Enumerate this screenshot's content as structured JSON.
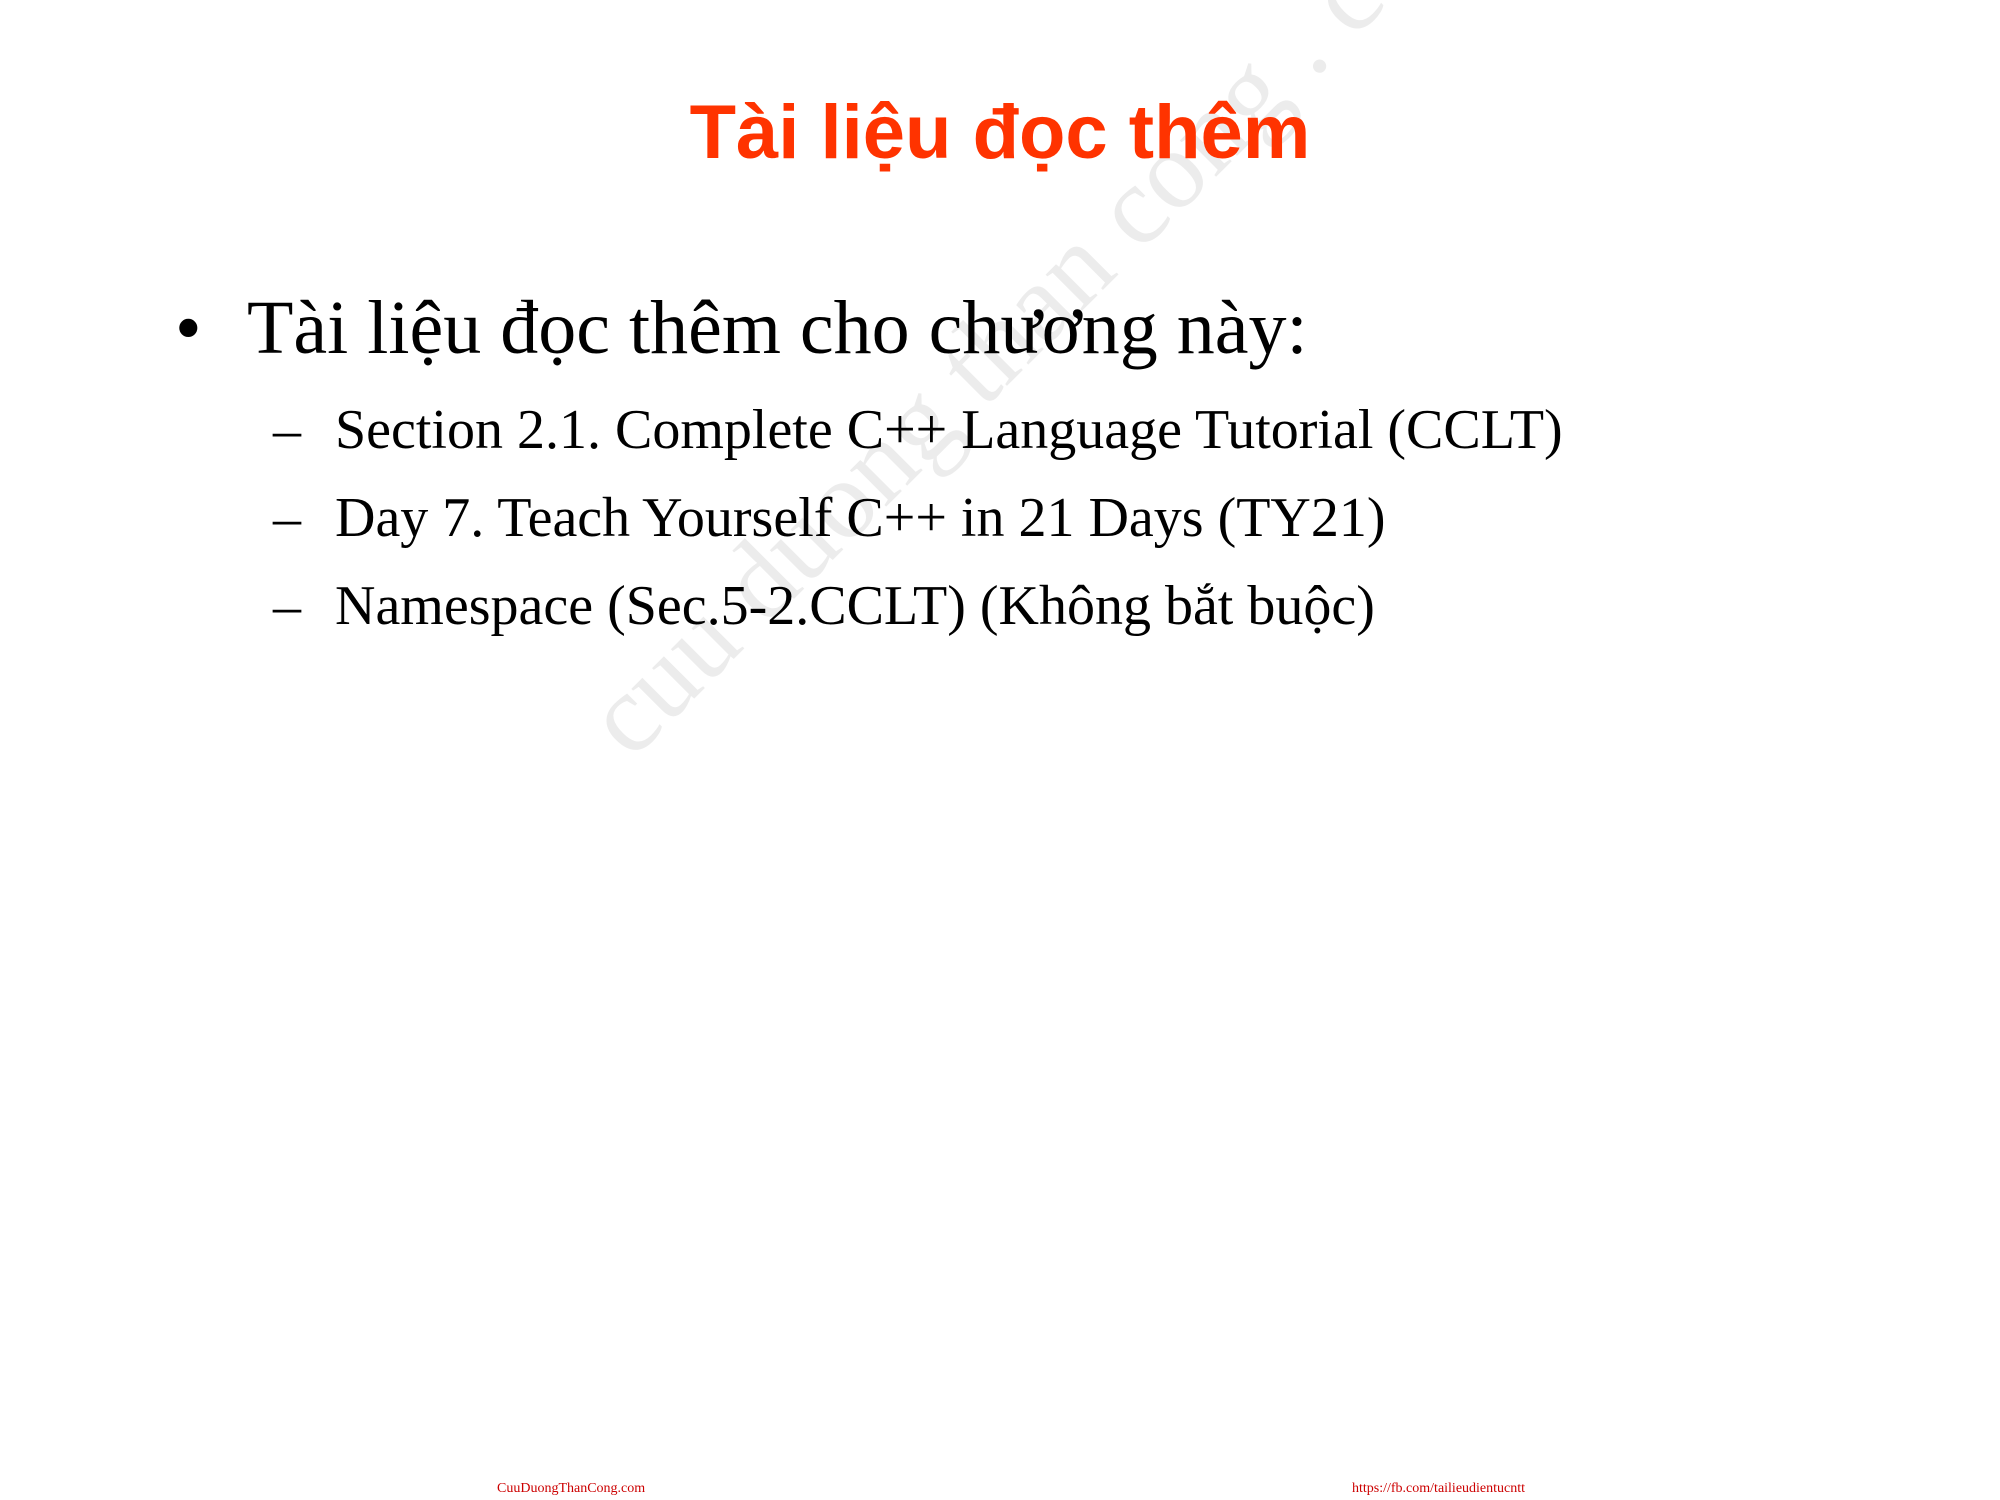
{
  "slide": {
    "title": "Tài liệu đọc thêm",
    "bullet": {
      "marker": "•",
      "text": "Tài liệu đọc thêm cho chương này:"
    },
    "sub_items": [
      {
        "marker": "–",
        "text": "Section 2.1. Complete C++ Language Tutorial (CCLT)"
      },
      {
        "marker": "–",
        "text": "Day 7. Teach Yourself C++ in 21 Days (TY21)"
      },
      {
        "marker": "–",
        "text": "Namespace (Sec.5-2.CCLT) (Không bắt buộc)"
      }
    ]
  },
  "watermark": {
    "text": "cuu duong than cong . com"
  },
  "footer": {
    "left": "CuuDuongThanCong.com",
    "right": "https://fb.com/tailieudientucntt"
  },
  "colors": {
    "title": "#ff3300",
    "body_text": "#000000",
    "footer_text": "#cc0000",
    "background": "#ffffff"
  }
}
